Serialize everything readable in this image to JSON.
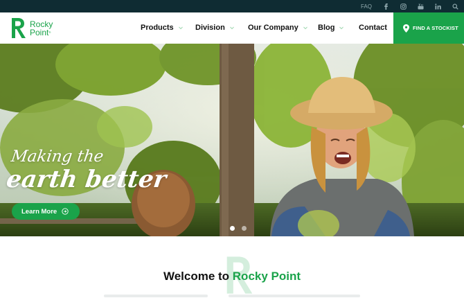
{
  "topbar": {
    "faq": "FAQ",
    "icons": [
      "facebook-icon",
      "instagram-icon",
      "youtube-icon",
      "linkedin-icon",
      "search-icon"
    ]
  },
  "header": {
    "logo": {
      "line1": "Rocky",
      "line2": "Point",
      "trademark": "®"
    },
    "nav": [
      {
        "label": "Products",
        "has_dropdown": true
      },
      {
        "label": "Division",
        "has_dropdown": true
      },
      {
        "label": "Our Company",
        "has_dropdown": true
      },
      {
        "label": "Blog",
        "has_dropdown": true
      },
      {
        "label": "Contact",
        "has_dropdown": false
      }
    ],
    "cta": "FIND A STOCKIST"
  },
  "hero": {
    "tagline_line1": "Making the",
    "tagline_line2": "earth better",
    "button": "Learn More",
    "slides": 2,
    "active_slide": 1
  },
  "welcome": {
    "title_prefix": "Welcome to ",
    "title_brand": "Rocky Point"
  },
  "colors": {
    "brand_green": "#1aa34a",
    "topbar_bg": "#0f2c33",
    "text_dark": "#111111"
  }
}
